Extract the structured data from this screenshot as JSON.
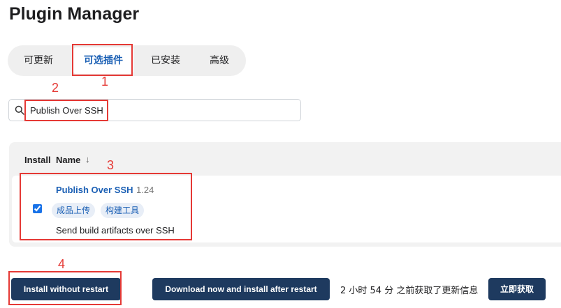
{
  "page": {
    "title": "Plugin Manager"
  },
  "tabs": [
    {
      "label": "可更新",
      "active": false
    },
    {
      "label": "可选插件",
      "active": true
    },
    {
      "label": "已安装",
      "active": false
    },
    {
      "label": "高级",
      "active": false
    }
  ],
  "search": {
    "value": "Publish Over SSH",
    "icon": "search-icon"
  },
  "table": {
    "headers": {
      "install": "Install",
      "name": "Name",
      "sort_indicator": "↓"
    },
    "rows": [
      {
        "checked": true,
        "name": "Publish Over SSH",
        "version": "1.24",
        "tags": [
          "成品上传",
          "构建工具"
        ],
        "description": "Send build artifacts over SSH"
      }
    ]
  },
  "actions": {
    "install_without_restart": "Install without restart",
    "download_and_install": "Download now and install after restart",
    "status": "2 小时 54 分 之前获取了更新信息",
    "fetch_now": "立即获取"
  },
  "annotations": [
    "1",
    "2",
    "3",
    "4"
  ],
  "colors": {
    "accent": "#1a5fb4",
    "button_bg": "#1e3a5f",
    "annotation": "#e53935",
    "panel_bg": "#f2f2f2"
  }
}
